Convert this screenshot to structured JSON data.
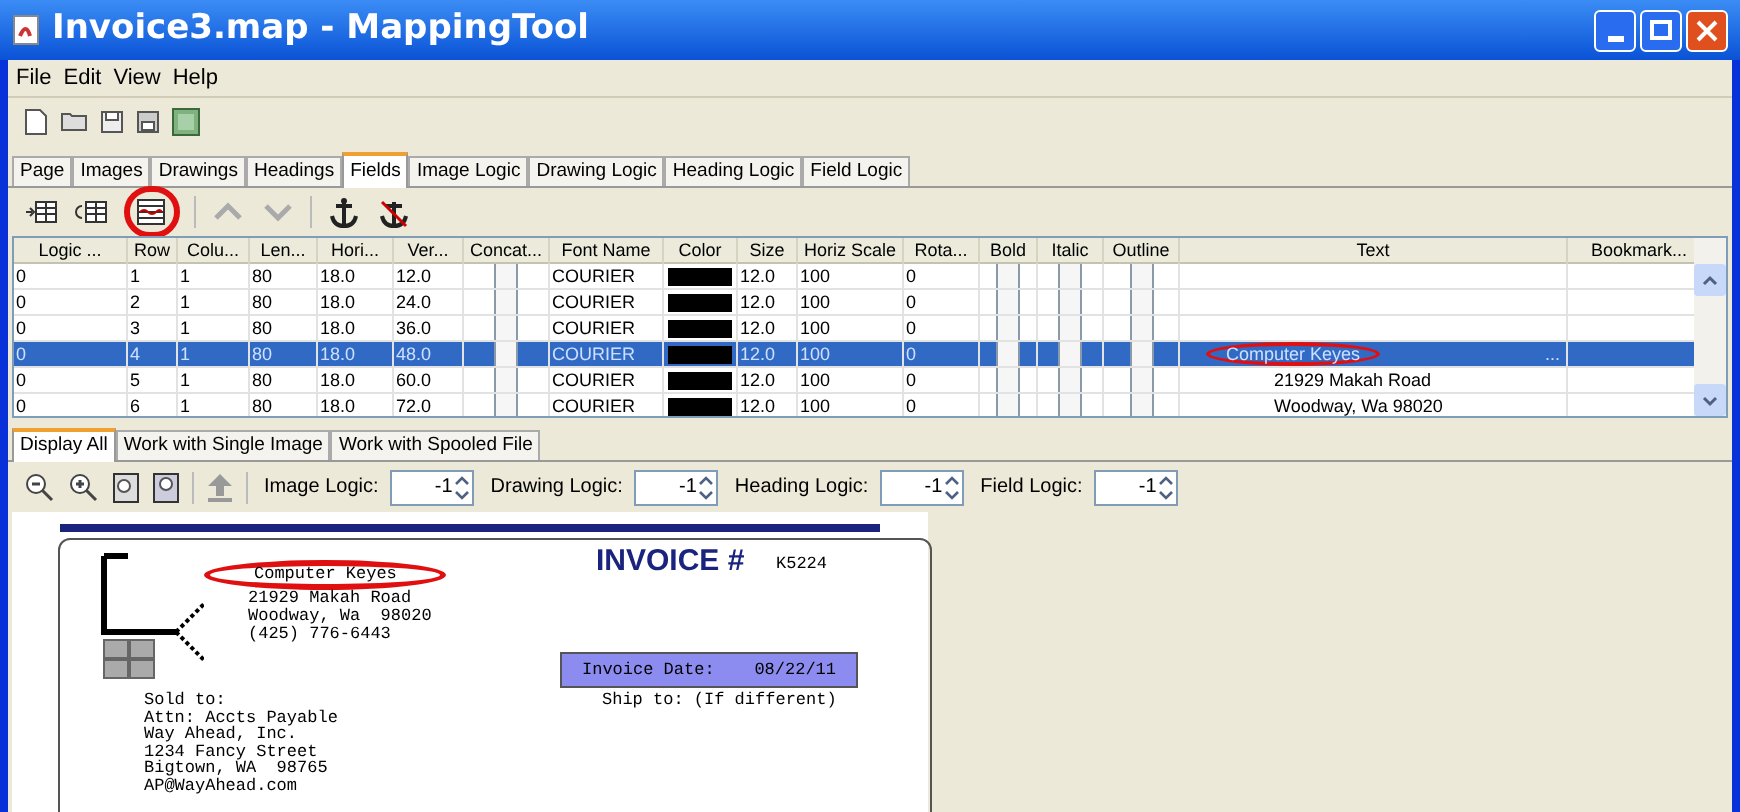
{
  "window": {
    "title": "Invoice3.map - MappingTool"
  },
  "menu": [
    "File",
    "Edit",
    "View",
    "Help"
  ],
  "tabs": [
    {
      "label": "Page",
      "selected": false
    },
    {
      "label": "Images",
      "selected": false
    },
    {
      "label": "Drawings",
      "selected": false
    },
    {
      "label": "Headings",
      "selected": false
    },
    {
      "label": "Fields",
      "selected": true
    },
    {
      "label": "Image Logic",
      "selected": false
    },
    {
      "label": "Drawing Logic",
      "selected": false
    },
    {
      "label": "Heading Logic",
      "selected": false
    },
    {
      "label": "Field Logic",
      "selected": false
    }
  ],
  "field_toolbar": [
    {
      "circled": false
    },
    {
      "circled": false
    },
    {
      "circled": true
    },
    {
      "circled": false
    },
    {
      "circled": false
    },
    {
      "circled": false
    },
    {
      "circled": false
    }
  ],
  "table": {
    "columns": [
      "Logic ...",
      "Row",
      "Colu...",
      "Len...",
      "Hori...",
      "Ver...",
      "Concat...",
      "Font Name",
      "Color",
      "Size",
      "Horiz Scale",
      "Rota...",
      "Bold",
      "Italic",
      "Outline",
      "Text",
      "Bookmark..."
    ],
    "rows": [
      {
        "logic": "0",
        "row": "1",
        "col": "1",
        "len": "80",
        "hori": "18.0",
        "ver": "12.0",
        "concat": false,
        "font": "COURIER",
        "color": "#000000",
        "size": "12.0",
        "hscale": "100",
        "rota": "0",
        "bold": false,
        "italic": false,
        "outline": false,
        "text": "",
        "circled": false,
        "selected": false
      },
      {
        "logic": "0",
        "row": "2",
        "col": "1",
        "len": "80",
        "hori": "18.0",
        "ver": "24.0",
        "concat": false,
        "font": "COURIER",
        "color": "#000000",
        "size": "12.0",
        "hscale": "100",
        "rota": "0",
        "bold": false,
        "italic": false,
        "outline": false,
        "text": "",
        "circled": false,
        "selected": false
      },
      {
        "logic": "0",
        "row": "3",
        "col": "1",
        "len": "80",
        "hori": "18.0",
        "ver": "36.0",
        "concat": false,
        "font": "COURIER",
        "color": "#000000",
        "size": "12.0",
        "hscale": "100",
        "rota": "0",
        "bold": false,
        "italic": false,
        "outline": false,
        "text": "",
        "circled": false,
        "selected": false
      },
      {
        "logic": "0",
        "row": "4",
        "col": "1",
        "len": "80",
        "hori": "18.0",
        "ver": "48.0",
        "concat": false,
        "font": "COURIER",
        "color": "#000000",
        "size": "12.0",
        "hscale": "100",
        "rota": "0",
        "bold": false,
        "italic": false,
        "outline": false,
        "text": "Computer Keyes",
        "ellipsis": "...",
        "circled": true,
        "selected": true
      },
      {
        "logic": "0",
        "row": "5",
        "col": "1",
        "len": "80",
        "hori": "18.0",
        "ver": "60.0",
        "concat": false,
        "font": "COURIER",
        "color": "#000000",
        "size": "12.0",
        "hscale": "100",
        "rota": "0",
        "bold": false,
        "italic": false,
        "outline": false,
        "text": "21929 Makah Road",
        "circled": false,
        "selected": false
      },
      {
        "logic": "0",
        "row": "6",
        "col": "1",
        "len": "80",
        "hori": "18.0",
        "ver": "72.0",
        "concat": false,
        "font": "COURIER",
        "color": "#000000",
        "size": "12.0",
        "hscale": "100",
        "rota": "0",
        "bold": false,
        "italic": false,
        "outline": false,
        "text": "Woodway, Wa  98020",
        "circled": false,
        "selected": false
      }
    ]
  },
  "bottom_tabs": [
    {
      "label": "Display All",
      "selected": true
    },
    {
      "label": "Work with Single Image",
      "selected": false
    },
    {
      "label": "Work with Spooled File",
      "selected": false
    }
  ],
  "spinners": [
    {
      "label": "Image Logic:",
      "value": "-1"
    },
    {
      "label": "Drawing Logic:",
      "value": "-1"
    },
    {
      "label": "Heading Logic:",
      "value": "-1"
    },
    {
      "label": "Field Logic:",
      "value": "-1"
    }
  ],
  "document": {
    "company_lines": [
      {
        "text": "Computer Keyes",
        "circled": true
      },
      {
        "text": "21929 Makah Road",
        "circled": false
      },
      {
        "text": "Woodway, Wa  98020",
        "circled": false
      },
      {
        "text": "(425) 776-6443",
        "circled": false
      }
    ],
    "invoice_title": "INVOICE #",
    "invoice_number": "K5224",
    "date_label": "Invoice Date:",
    "date_value": "08/22/11",
    "ship_to": "Ship to: (If different)",
    "sold_to": [
      "Sold to:",
      "Attn: Accts Payable",
      "Way Ahead, Inc.",
      "1234 Fancy Street",
      "Bigtown, WA  98765",
      "AP@WayAhead.com"
    ]
  }
}
